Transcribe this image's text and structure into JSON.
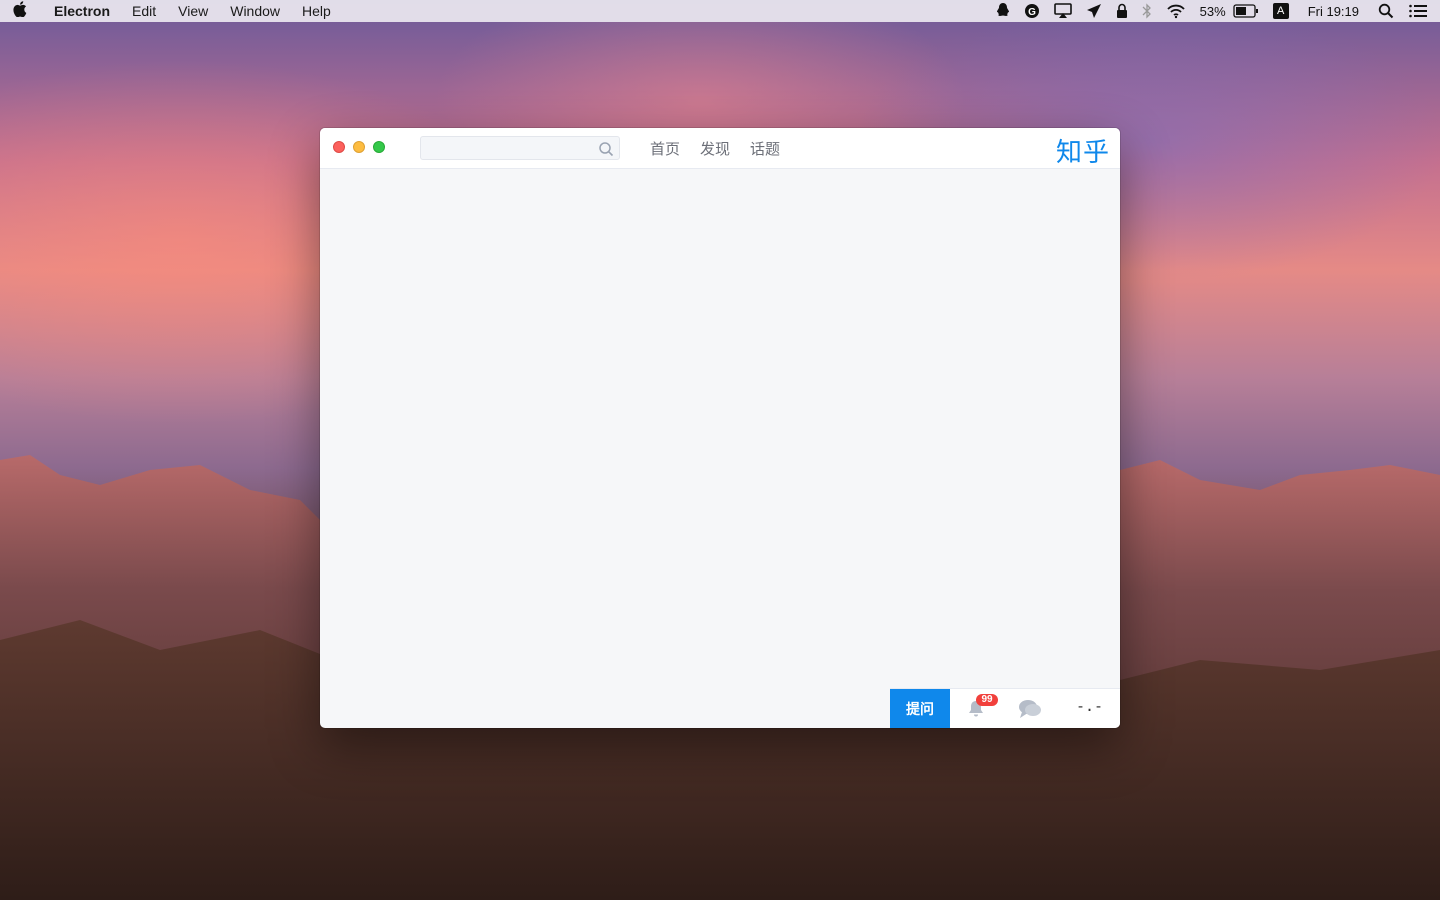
{
  "menubar": {
    "app_name": "Electron",
    "items": [
      "Edit",
      "View",
      "Window",
      "Help"
    ],
    "battery_percent": "53%",
    "clock": "Fri 19:19",
    "input_source": "A",
    "status_icons": [
      "qq-icon",
      "grammarly-icon",
      "airplay-icon",
      "send-icon",
      "lock-icon",
      "bluetooth-icon",
      "wifi-icon",
      "battery-icon",
      "input-source-icon",
      "spotlight-icon",
      "notification-center-icon"
    ]
  },
  "window": {
    "search": {
      "value": "",
      "placeholder": ""
    },
    "nav": [
      "首页",
      "发现",
      "话题"
    ],
    "logo": "知乎",
    "bottom": {
      "ask_label": "提问",
      "notification_count": "99",
      "avatar_text": "-.-"
    }
  },
  "colors": {
    "accent": "#0f88eb",
    "badge": "#f1403c",
    "close": "#fc605c",
    "minimize": "#fdbc40",
    "maximize": "#34c84a"
  }
}
